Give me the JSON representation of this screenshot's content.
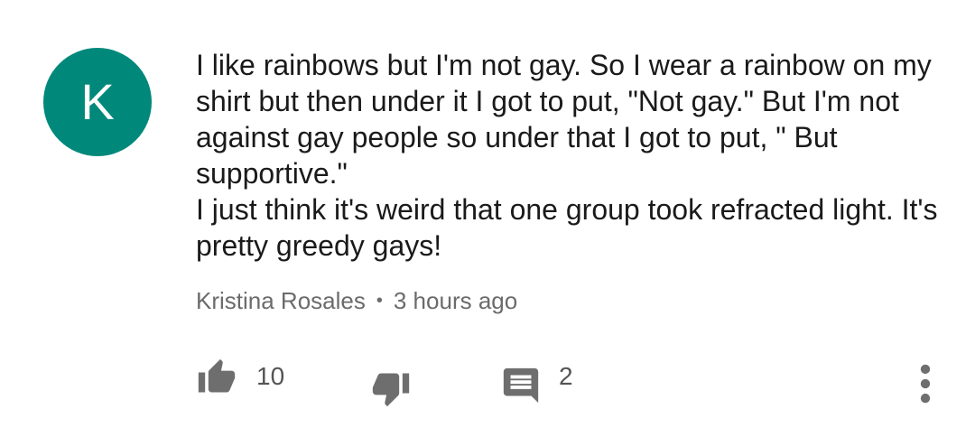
{
  "comment": {
    "avatar_letter": "K",
    "avatar_color": "#00897b",
    "text": "I like rainbows but I'm not gay. So I wear a rainbow on my shirt but then under it I got to put, \"Not gay.\" But I'm not against gay people so under that I got to put, \" But supportive.\"\nI just think it's weird that one group took refracted light. It's pretty greedy gays!",
    "author": "Kristina Rosales",
    "separator": "•",
    "timestamp": "3 hours ago"
  },
  "actions": {
    "like_icon": "thumbs-up-icon",
    "like_count": "10",
    "dislike_icon": "thumbs-down-icon",
    "reply_icon": "comment-icon",
    "reply_count": "2",
    "more_icon": "more-vertical-icon"
  }
}
